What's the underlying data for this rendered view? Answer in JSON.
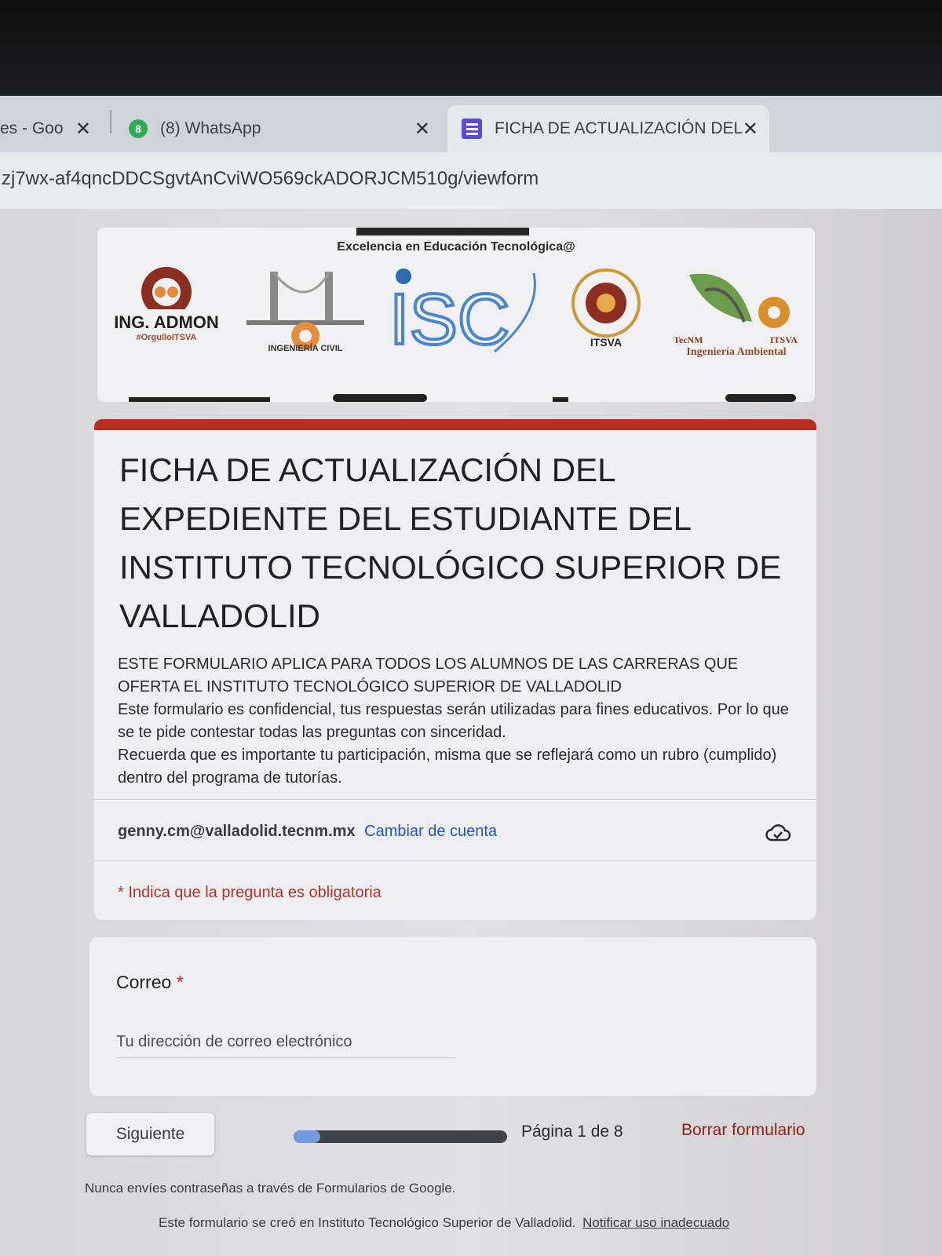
{
  "browser": {
    "tabs": [
      {
        "label": "es - Goo",
        "icon": "google-icon"
      },
      {
        "label": "(8) WhatsApp",
        "badge": "8",
        "icon": "whatsapp-icon"
      },
      {
        "label": "FICHA DE ACTUALIZACIÓN DEL",
        "icon": "google-forms-icon",
        "active": true
      }
    ],
    "new_tab": "+",
    "url": "zj7wx-af4qncDDCSgvtAnCviWO569ckADORJCM510g/viewform"
  },
  "banner": {
    "slogan": "Excelencia en Educación Tecnológica@",
    "logos": [
      {
        "name": "ing-admon-logo",
        "title": "ING. ADMON",
        "subtitle": "#OrgulloITSVA"
      },
      {
        "name": "ingenieria-civil-logo",
        "title": "INGENIERÍA CIVIL"
      },
      {
        "name": "isc-logo",
        "title": "ISC"
      },
      {
        "name": "ingenieria-industrial-logo",
        "title": "ITSVA"
      },
      {
        "name": "ingenieria-ambiental-logo",
        "title": "Ingeniería Ambiental",
        "left": "TecNM",
        "right": "ITSVA"
      }
    ]
  },
  "form": {
    "accent_color": "#b72d20",
    "title": "FICHA DE ACTUALIZACIÓN DEL EXPEDIENTE DEL ESTUDIANTE DEL INSTITUTO TECNOLÓGICO SUPERIOR DE VALLADOLID",
    "description": [
      "ESTE FORMULARIO APLICA PARA TODOS LOS ALUMNOS DE  LAS CARRERAS QUE OFERTA EL INSTITUTO TECNOLÓGICO SUPERIOR DE VALLADOLID",
      "Este formulario es confidencial,  tus respuestas serán utilizadas para fines educativos. Por lo que se te pide contestar todas las preguntas con  sinceridad.",
      "Recuerda que es importante tu participación, misma que se reflejará como un rubro (cumplido) dentro del programa de tutorías."
    ],
    "account_email": "genny.cm@valladolid.tecnm.mx",
    "switch_account": "Cambiar de cuenta",
    "required_note": "* Indica que la pregunta es obligatoria",
    "question": {
      "label": "Correo",
      "required_mark": "*",
      "placeholder": "Tu dirección de correo electrónico"
    },
    "next_button": "Siguiente",
    "progress_fraction": 0.125,
    "page_indicator": "Página 1 de 8",
    "clear_form": "Borrar formulario",
    "footer_note": "Nunca envíes contraseñas a través de Formularios de Google.",
    "footer_created": "Este formulario se creó en Instituto Tecnológico Superior de Valladolid.",
    "footer_report": "Notificar uso inadecuado"
  }
}
